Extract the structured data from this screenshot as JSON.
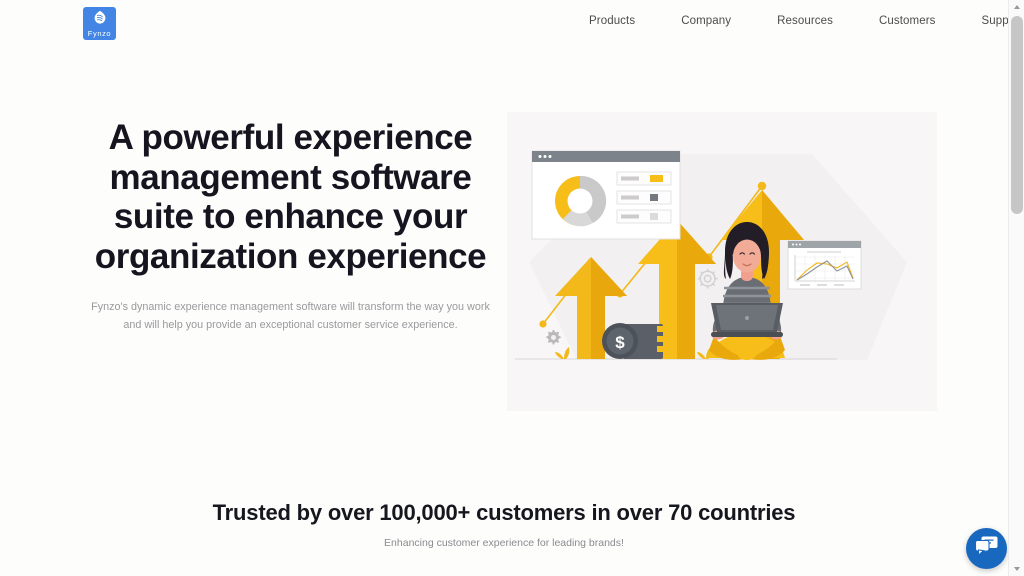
{
  "brand": {
    "logo_text": "Fynzo",
    "logo_icon": "fynzo-leaf-icon",
    "logo_bg": "#4285e4"
  },
  "nav": {
    "items": [
      {
        "label": "Products"
      },
      {
        "label": "Company"
      },
      {
        "label": "Resources"
      },
      {
        "label": "Customers"
      },
      {
        "label": "Support"
      }
    ]
  },
  "hero": {
    "title": "A powerful experience management software suite to enhance your organization experience",
    "subtitle": "Fynzo's dynamic experience management software will transform the way you work and will help you provide an exceptional customer service experience.",
    "illustration": {
      "name": "business-growth-illustration",
      "panel_bg": "#f8f6f7",
      "accent_yellow": "#f5b915",
      "accent_yellow_light": "#fbc82a",
      "accent_gray": "#6b7077",
      "elements": [
        "growth-arrow-small",
        "growth-arrow-medium",
        "growth-arrow-large",
        "zigzag-trend-line",
        "donut-chart-window",
        "line-chart-window",
        "coin-stack",
        "gear-icons",
        "woman-with-laptop",
        "plant-sprouts"
      ]
    }
  },
  "trusted": {
    "title": "Trusted by over 100,000+ customers in over 70 countries",
    "subtitle": "Enhancing customer experience for leading brands!"
  },
  "chat": {
    "icon": "chat-bubbles-icon",
    "color": "#1868c0"
  },
  "scrollbar": {
    "up_arrow": "scroll-up-arrow",
    "down_arrow": "scroll-down-arrow"
  }
}
